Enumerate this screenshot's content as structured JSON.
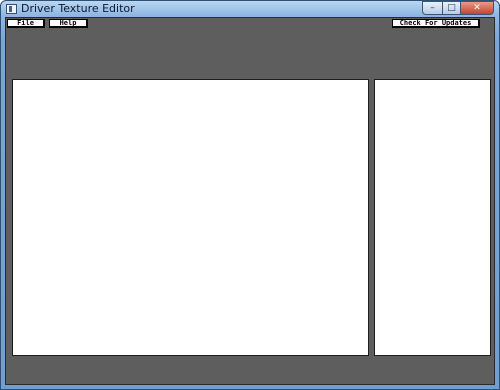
{
  "window": {
    "title": "Driver Texture Editor",
    "controls": {
      "minimize_glyph": "–",
      "maximize_glyph": "□",
      "close_glyph": "✕"
    }
  },
  "menu": {
    "file_label": "File",
    "help_label": "Help",
    "check_updates_label": "Check For Updates"
  },
  "colors": {
    "client_background": "#5e5e5e",
    "panel_background": "#ffffff",
    "button_background": "#ffffff"
  },
  "icons": {
    "app": "window-app-icon",
    "minimize": "minimize-icon",
    "maximize": "maximize-icon",
    "close": "close-icon"
  }
}
